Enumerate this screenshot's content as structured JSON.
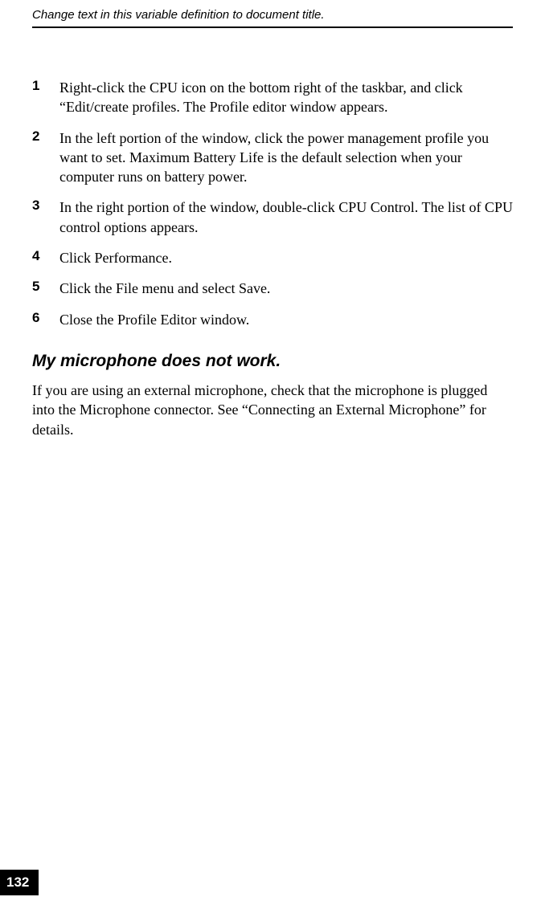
{
  "header": {
    "title": "Change text in this variable definition to document title."
  },
  "steps": [
    {
      "num": "1",
      "text": "Right-click the CPU icon on the bottom right of the taskbar, and click “Edit/create profiles. The Profile editor window appears."
    },
    {
      "num": "2",
      "text": "In the left portion of the window, click the power management profile you want to set. Maximum Battery Life is the default selection when your computer runs on battery power."
    },
    {
      "num": "3",
      "text": "In the right portion of the window, double-click CPU Control. The list of CPU control options appears."
    },
    {
      "num": "4",
      "text": "Click Performance."
    },
    {
      "num": "5",
      "text": "Click the File menu and select Save."
    },
    {
      "num": "6",
      "text": "Close the Profile Editor window."
    }
  ],
  "section": {
    "heading": "My microphone does not work.",
    "body": "If you are using an external microphone, check that the microphone is plugged into the Microphone connector. See “Connecting an External Microphone” for details."
  },
  "page_number": "132"
}
